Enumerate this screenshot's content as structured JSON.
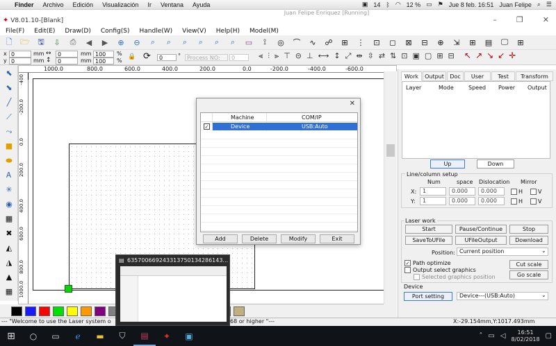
{
  "mac_menubar": {
    "apple": "",
    "items": [
      "Finder",
      "Archivo",
      "Edición",
      "Visualización",
      "Ir",
      "Ventana",
      "Ayuda"
    ],
    "status": {
      "battery": "12 %",
      "datetime": "Jue 8 feb.  16:51",
      "user": "Juan Felipe",
      "wifi_count": "14"
    }
  },
  "vm_title": "Juan Felipe Enriquez [Running]",
  "app_title": "V8.01.10-[Blank]",
  "app_menu": [
    "File(F)",
    "Edit(E)",
    "Draw(D)",
    "Config(S)",
    "Handle(W)",
    "View(V)",
    "Help(H)",
    "Model(M)"
  ],
  "toolbar2": {
    "x_value": "0",
    "y_value": "0",
    "unit_x": "mm",
    "unit_y": "mm",
    "w_value": "0",
    "h_value": "0",
    "pct_w": "100",
    "pct_h": "100",
    "rotate_value": "0",
    "rotate_unit": "°",
    "process_label": "Process NO:",
    "process_value": "0"
  },
  "ruler": {
    "h_labels": [
      "1000.0",
      "800.0",
      "600.0",
      "400.0",
      "200.0",
      "0.0",
      "-200.0",
      "-400.0",
      "-600.0"
    ],
    "v_labels": [
      "-400",
      "-200.0",
      "0.0",
      "200.0",
      "400.0",
      "600.0",
      "800.0",
      "1000.0"
    ]
  },
  "right_panel": {
    "tabs": [
      "Work",
      "Output",
      "Doc",
      "User",
      "Test",
      "Transform"
    ],
    "active_tab": "Work",
    "layer_columns": [
      "Layer",
      "Mode",
      "Speed",
      "Power",
      "Output"
    ],
    "up_label": "Up",
    "down_label": "Down",
    "line_column_setup": {
      "title": "Line/column setup",
      "headers": [
        "Num",
        "space",
        "Dislocation",
        "Mirror"
      ],
      "x_row": {
        "label": "X:",
        "num": "1",
        "space": "0.000",
        "dislocation": "0.000",
        "h": "H",
        "v": "V"
      },
      "y_row": {
        "label": "Y:",
        "num": "1",
        "space": "0.000",
        "dislocation": "0.000",
        "h": "H",
        "v": "V"
      }
    },
    "laser_work": {
      "title": "Laser work",
      "buttons": [
        "Start",
        "Pause/Continue",
        "Stop",
        "SaveToUFile",
        "UFileOutput",
        "Download"
      ],
      "position_label": "Position:",
      "position_value": "Current position",
      "path_optimize": "Path optimize",
      "output_select": "Output select graphics",
      "selected_pos": "Selected graphics position",
      "cut_scale": "Cut scale",
      "go_scale": "Go scale"
    },
    "device": {
      "title": "Device",
      "port_setting": "Port setting",
      "device_value": "Device---(USB:Auto)"
    }
  },
  "dialog": {
    "close": "✕",
    "columns": [
      "Machine",
      "COM/IP"
    ],
    "rows": [
      {
        "checked": "✓",
        "machine": "Device",
        "comip": "USB:Auto"
      }
    ],
    "buttons": [
      "Add",
      "Delete",
      "Modify",
      "Exit"
    ]
  },
  "colors": [
    "#000000",
    "#1a1aff",
    "#ff0000",
    "#00e000",
    "#ffff00",
    "#ff9900",
    "#800080",
    "#808080",
    "#00b0b0",
    "#80ff80",
    "#ff80ff",
    "#a0a0ff",
    "#c0c0c0",
    "#ffb0c0",
    "#e080ff",
    "#8080c0",
    "#c0b080"
  ],
  "status_bar": {
    "left": "--- \"Welcome to use the Laser system o",
    "left_tail": "68 or higher \"---",
    "coords": "X:-29.154mm,Y:1017.493mm"
  },
  "taskbar_thumb_title": "6357006692433137501342861​43...",
  "taskbar": {
    "time": "16:51",
    "date": "8/02/2018"
  }
}
